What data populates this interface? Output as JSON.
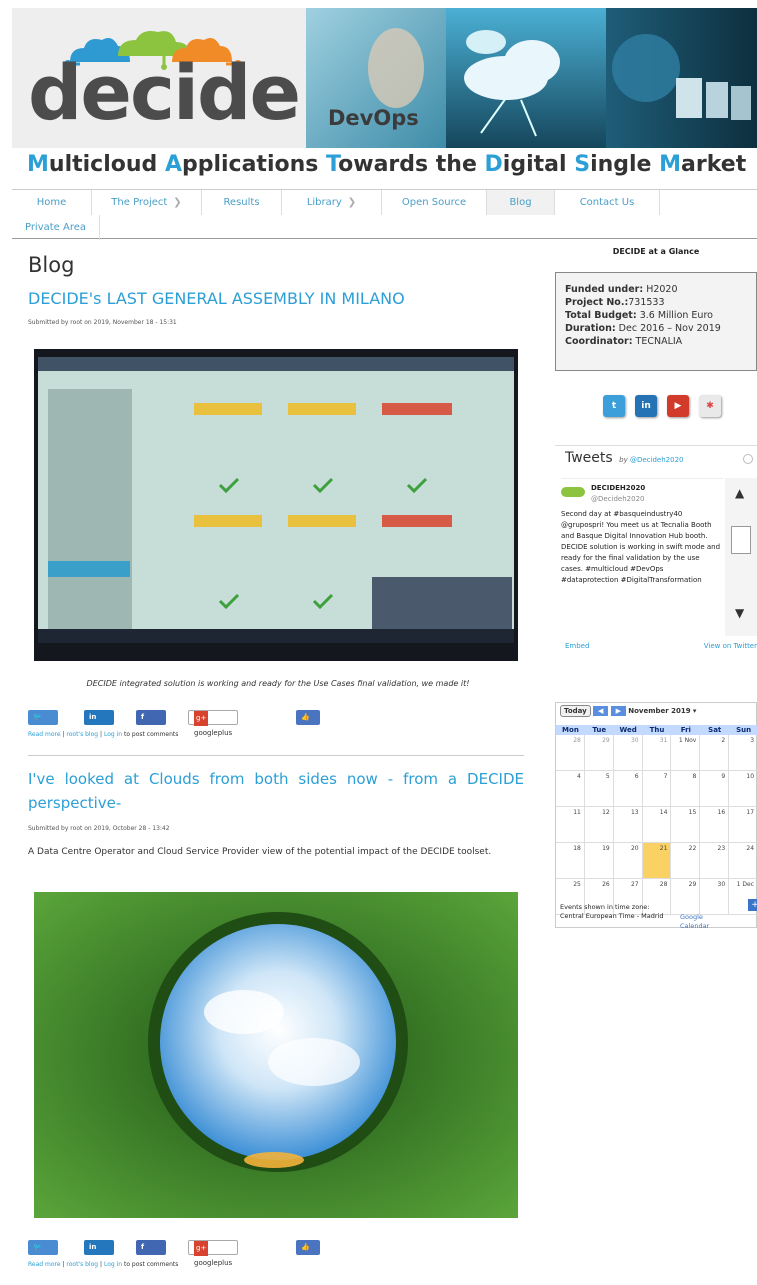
{
  "header": {
    "logo_text": "decide",
    "banner_text": "DevOps",
    "tagline_parts": [
      {
        "cap": "M",
        "rest": "ulticloud "
      },
      {
        "cap": "A",
        "rest": "pplications "
      },
      {
        "cap": "T",
        "rest": "owards the "
      },
      {
        "cap": "D",
        "rest": "igital "
      },
      {
        "cap": "S",
        "rest": "ingle "
      },
      {
        "cap": "M",
        "rest": "arket"
      }
    ]
  },
  "nav": {
    "items": [
      {
        "label": "Home"
      },
      {
        "label": "The Project"
      },
      {
        "label": "Results"
      },
      {
        "label": "Library"
      },
      {
        "label": "Open Source"
      },
      {
        "label": "Blog"
      },
      {
        "label": "Contact Us"
      },
      {
        "label": "Private Area"
      }
    ],
    "arrow": "❯"
  },
  "main": {
    "page_title": "Blog",
    "post1": {
      "title": "DECIDE's LAST GENERAL ASSEMBLY IN MILANO",
      "submitted": "Submitted by root on 2019, November 18 - 15:31",
      "caption": "DECIDE integrated solution is working and ready for the Use Cases final validation, we made it!"
    },
    "post2": {
      "title": "I've looked at Clouds from both sides now - from a DECIDE perspective-",
      "submitted": "Submitted by root on 2019, October 28 - 13:42",
      "teaser": "A Data Centre Operator and Cloud Service Provider view of the potential impact of the DECIDE toolset."
    },
    "share": {
      "tweet": "Tweet",
      "linkedin": "Share",
      "facebook": "Share",
      "google": "googleplus",
      "like": "Like 0"
    },
    "links": {
      "read_more": "Read more",
      "blog": "root's blog",
      "login": "Log in",
      "login_suffix": "to post comments"
    }
  },
  "sidebar": {
    "glance_title": "DECIDE at a Glance",
    "glance": [
      {
        "label": "Funded under:",
        "value": "H2020"
      },
      {
        "label": "Project No.:",
        "value": "731533"
      },
      {
        "label": "Total Budget:",
        "value": "3.6 Million Euro"
      },
      {
        "label": "Duration:",
        "value": "Dec 2016 – Nov 2019"
      },
      {
        "label": "Coordinator:",
        "value": "TECNALIA"
      }
    ],
    "tweets": {
      "title": "Tweets",
      "by": "by",
      "handle": "@Decideh2020",
      "user_name": "DECIDEH2020",
      "user_handle": "@Decideh2020",
      "text": "Second day at #basqueindustry40 @grupospri! You meet us at Tecnalia Booth and Basque Digital Innovation Hub booth. DECIDE solution is working in swift mode and ready for the final validation by the use cases. #multicloud #DevOps #dataprotection #DigitalTransformation",
      "embed": "Embed",
      "view": "View on Twitter"
    },
    "calendar": {
      "today": "Today",
      "month": "November 2019",
      "days": [
        "Mon",
        "Tue",
        "Wed",
        "Thu",
        "Fri",
        "Sat",
        "Sun"
      ],
      "weeks": [
        [
          "28",
          "29",
          "30",
          "31",
          "1 Nov",
          "2",
          "3"
        ],
        [
          "4",
          "5",
          "6",
          "7",
          "8",
          "9",
          "10"
        ],
        [
          "11",
          "12",
          "13",
          "14",
          "15",
          "16",
          "17"
        ],
        [
          "18",
          "19",
          "20",
          "21",
          "22",
          "23",
          "24"
        ],
        [
          "25",
          "26",
          "27",
          "28",
          "29",
          "30",
          "1 Dec"
        ]
      ],
      "tz_text": "Events shown in time zone: Central European Time - Madrid",
      "google": "Google Calendar"
    }
  },
  "colors": {
    "accent": "#2b9fd6",
    "logo_grey": "#4c4c4c"
  }
}
